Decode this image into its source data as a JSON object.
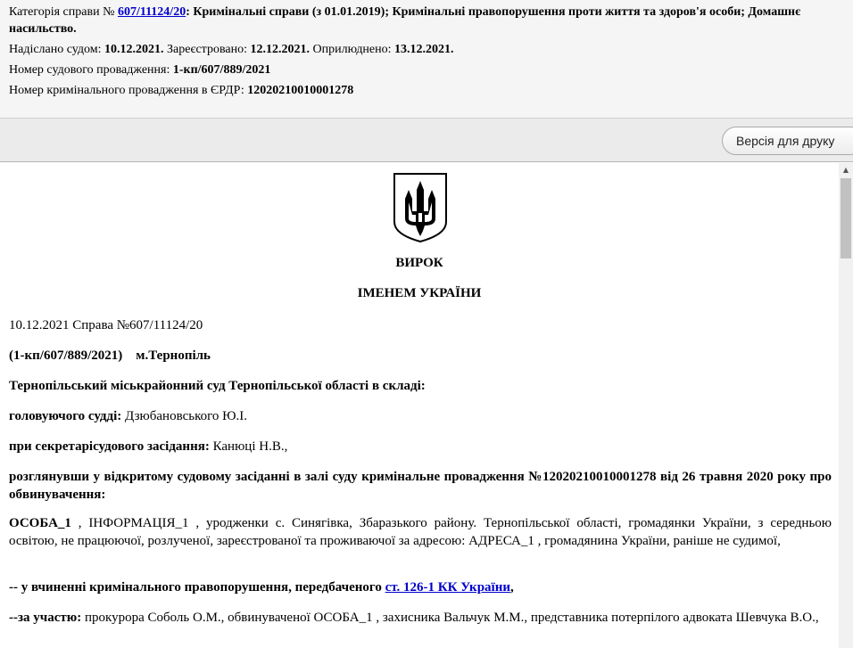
{
  "meta": {
    "category_prefix": "Категорія справи №",
    "case_link": "607/11124/20",
    "category_text": ": Кримінальні справи (з 01.01.2019); Кримінальні правопорушення проти життя та здоров'я особи; Домашнє насильство.",
    "sent_label": "Надіслано судом: ",
    "sent_date": "10.12.2021.",
    "registered_label": " Зареєстровано: ",
    "registered_date": "12.12.2021.",
    "published_label": " Оприлюднено: ",
    "published_date": "13.12.2021.",
    "court_proc_label": "Номер судового провадження: ",
    "court_proc_value": "1-кп/607/889/2021",
    "erdr_label": "Номер кримінального провадження в ЄРДР: ",
    "erdr_value": "12020210010001278"
  },
  "toolbar": {
    "print_label": "Версія для друку"
  },
  "scrollbar": {
    "up_arrow": "▲"
  },
  "document": {
    "title": "ВИРОК",
    "subtitle": "ІМЕНЕМ УКРАЇНИ",
    "date_case": "10.12.2021 Справа №607/11124/20",
    "proc_number": "(1-кп/607/889/2021)",
    "city": "м.Тернопіль",
    "court": "Тернопільський міськрайонний суд Тернопільської області в складі:",
    "judge_label": "головуючого судді:",
    "judge_name": " Дзюбановського Ю.І.",
    "secretary_label": "при секретарісудового засідання:",
    "secretary_name": " Канюці Н.В.,",
    "considering": "розглянувши у відкритому судовому засіданні в залі суду кримінальне провадження №12020210010001278 від 26 травня 2020 року про обвинувачення:",
    "person_name": "ОСОБА_1",
    "person_desc": " , ІНФОРМАЦІЯ_1 , уродженки с. Синягівка, Збаразького району. Тернопільської області, громадянки України, з середньою освітою, не працюючої, розлученої, зареєстрованої та проживаючої за адресою: АДРЕСА_1 , громадянина України, раніше не судимої,",
    "charge_text": "-- у вчиненні кримінального правопорушення, передбаченого ",
    "charge_link": "ст. 126-1 КК України",
    "charge_end": ",",
    "participation_label": "--за участю:",
    "participation_text": " прокурора Соболь О.М., обвинуваченої ОСОБА_1 , захисника Вальчук М.М., представника потерпілого адвоката Шевчука В.О.,"
  }
}
